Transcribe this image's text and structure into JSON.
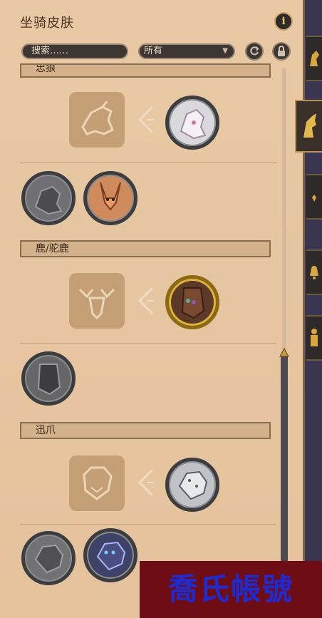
{
  "panel": {
    "title": "坐骑皮肤",
    "info_icon_glyph": "i"
  },
  "toolbar": {
    "search_placeholder": "搜索……",
    "filter_value": "所有"
  },
  "sections": [
    {
      "title": "忠狼",
      "title_partially_hidden": true
    },
    {
      "title": "鹿/驼鹿"
    },
    {
      "title": "迅爪"
    }
  ],
  "skins": {
    "wolf_selected": {
      "icon": "white-wolf-skin-icon"
    },
    "wolf_option_1": {
      "icon": "grey-wolf-skin-icon"
    },
    "wolf_option_2": {
      "icon": "fox-skin-icon"
    },
    "deer_selected": {
      "icon": "hooded-deer-skin-icon",
      "accent": "#c99a2e"
    },
    "deer_option_1": {
      "icon": "grey-deer-skin-icon"
    },
    "claw_selected": {
      "icon": "snow-leopard-skin-icon"
    },
    "claw_option_1": {
      "icon": "grey-leopard-skin-icon"
    },
    "claw_option_2": {
      "icon": "blue-panther-skin-icon"
    }
  },
  "watermark": "喬氏帳號",
  "colors": {
    "panel_bg": "#e6c59f",
    "section_bg": "#d3b18b",
    "placeholder_bg": "#c49e74",
    "watermark_bg": "#6e0d14",
    "watermark_text": "#1d2bd4"
  }
}
